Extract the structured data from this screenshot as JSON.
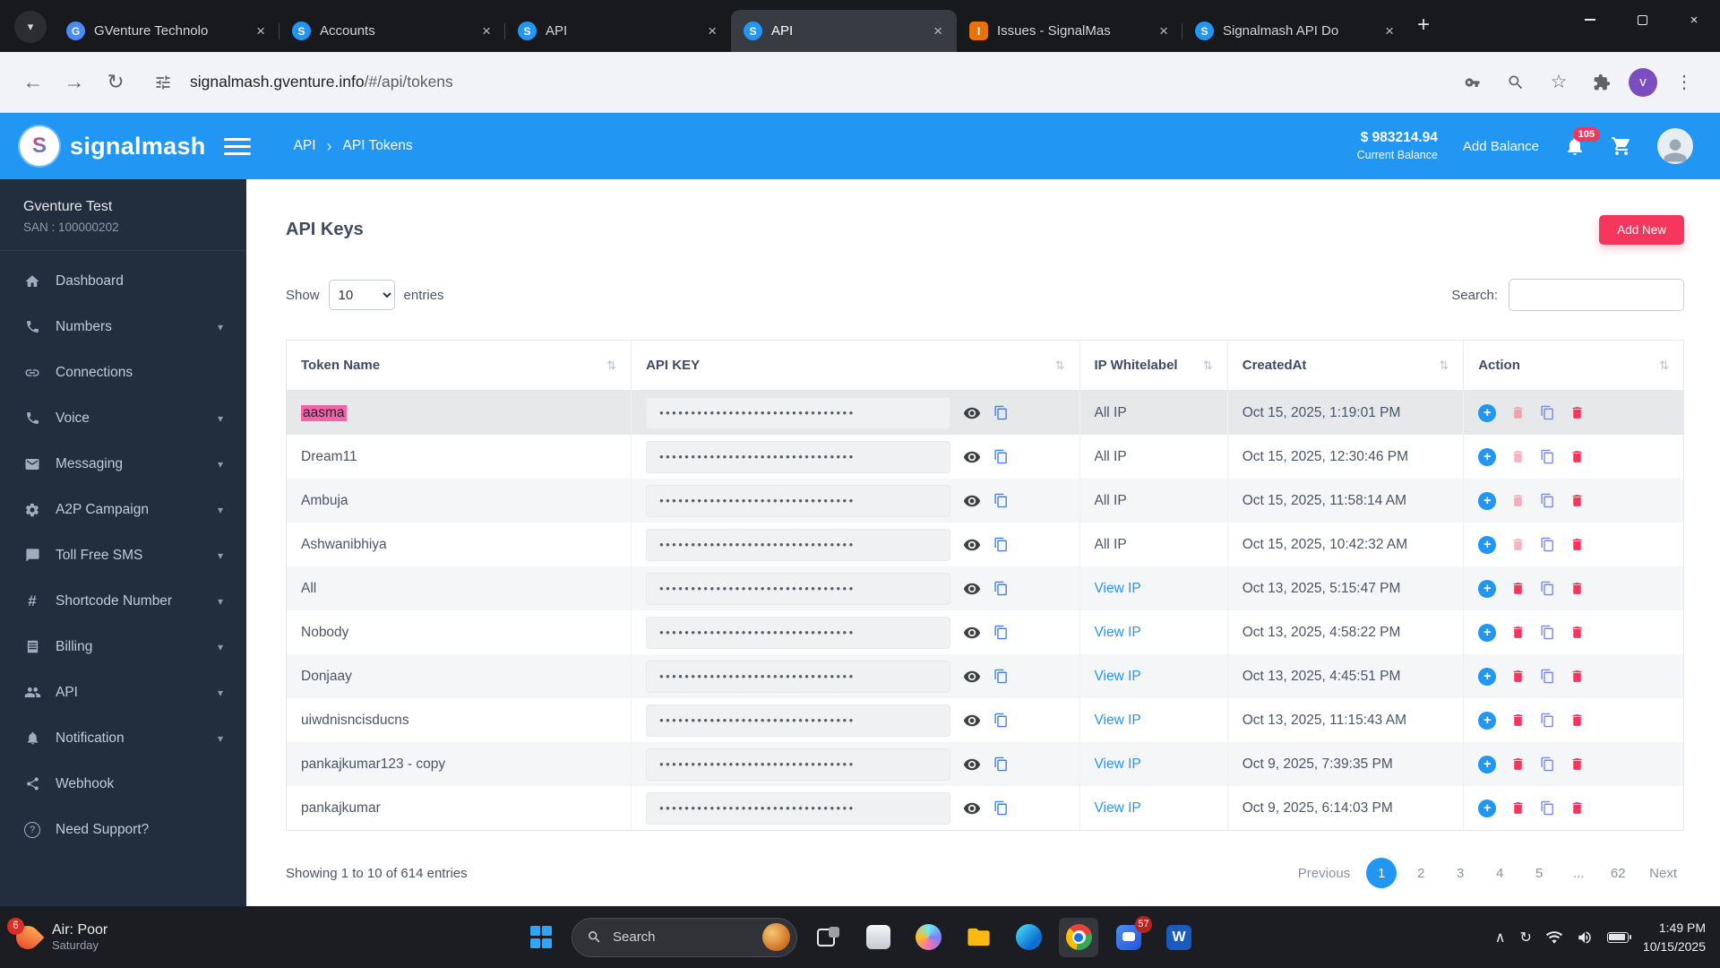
{
  "colors": {
    "appbar_blue": "#2196f3",
    "accent_pink": "#f5365c",
    "link_blue": "#2196f3",
    "highlight_pink": "#f263a8",
    "sidebar_dark": "#222e3e"
  },
  "browser": {
    "tabs": [
      {
        "title": "GVenture Technolo",
        "favicon": "gventure-favicon",
        "favicon_letter": "G"
      },
      {
        "title": "Accounts",
        "favicon": "signalmash-favicon",
        "favicon_letter": "S"
      },
      {
        "title": "API",
        "favicon": "signalmash-favicon",
        "favicon_letter": "S"
      },
      {
        "title": "API",
        "favicon": "signalmash-favicon",
        "favicon_letter": "S"
      },
      {
        "title": "Issues - SignalMas",
        "favicon": "issues-favicon",
        "favicon_letter": "I"
      },
      {
        "title": "Signalmash API Do",
        "favicon": "signalmash-favicon",
        "favicon_letter": "S"
      }
    ],
    "url_host": "signalmash.gventure.info",
    "url_path": "/#/api/tokens",
    "profile_initial": "v"
  },
  "appbar": {
    "logo_letter": "S",
    "brand": "signalmash",
    "breadcrumb_root": "API",
    "breadcrumb_sep": "›",
    "breadcrumb_current": "API Tokens",
    "balance_amount": "$ 983214.94",
    "balance_label": "Current Balance",
    "add_balance_label": "Add Balance",
    "notification_count": "105"
  },
  "sidebar": {
    "account_name": "Gventure Test",
    "account_san": "SAN : 100000202",
    "items": [
      {
        "label": "Dashboard",
        "icon": "home-icon"
      },
      {
        "label": "Numbers",
        "icon": "phone-icon"
      },
      {
        "label": "Connections",
        "icon": "link-icon"
      },
      {
        "label": "Voice",
        "icon": "call-icon"
      },
      {
        "label": "Messaging",
        "icon": "mail-icon"
      },
      {
        "label": "A2P Campaign",
        "icon": "gear-icon"
      },
      {
        "label": "Toll Free SMS",
        "icon": "chat-icon"
      },
      {
        "label": "Shortcode Number",
        "icon": "hash-icon"
      },
      {
        "label": "Billing",
        "icon": "receipt-icon"
      },
      {
        "label": "API",
        "icon": "users-icon"
      },
      {
        "label": "Notification",
        "icon": "bell-icon"
      },
      {
        "label": "Webhook",
        "icon": "webhook-icon"
      },
      {
        "label": "Need Support?",
        "icon": "question-icon"
      }
    ]
  },
  "main": {
    "page_title": "API Keys",
    "add_new_label": "Add New",
    "show_label": "Show",
    "page_size": "10",
    "entries_label": "entries",
    "search_label": "Search:",
    "table": {
      "columns": [
        "Token Name",
        "API KEY",
        "IP Whitelabel",
        "CreatedAt",
        "Action"
      ],
      "masked_key": "•••••••••••••••••••••••••••••••",
      "rows": [
        {
          "name": "aasma",
          "ip": "All IP",
          "created": "Oct 15, 2025, 1:19:01 PM"
        },
        {
          "name": "Dream11",
          "ip": "All IP",
          "created": "Oct 15, 2025, 12:30:46 PM"
        },
        {
          "name": "Ambuja",
          "ip": "All IP",
          "created": "Oct 15, 2025, 11:58:14 AM"
        },
        {
          "name": "Ashwanibhiya",
          "ip": "All IP",
          "created": "Oct 15, 2025, 10:42:32 AM"
        },
        {
          "name": "All",
          "ip": "View IP",
          "created": "Oct 13, 2025, 5:15:47 PM"
        },
        {
          "name": "Nobody",
          "ip": "View IP",
          "created": "Oct 13, 2025, 4:58:22 PM"
        },
        {
          "name": "Donjaay",
          "ip": "View IP",
          "created": "Oct 13, 2025, 4:45:51 PM"
        },
        {
          "name": "uiwdnisncisducns",
          "ip": "View IP",
          "created": "Oct 13, 2025, 11:15:43 AM"
        },
        {
          "name": "pankajkumar123 - copy",
          "ip": "View IP",
          "created": "Oct 9, 2025, 7:39:35 PM"
        },
        {
          "name": "pankajkumar",
          "ip": "View IP",
          "created": "Oct 9, 2025, 6:14:03 PM"
        }
      ]
    },
    "footer_text": "Showing 1 to 10 of 614 entries",
    "pagination": {
      "prev": "Previous",
      "pages": [
        "1",
        "2",
        "3",
        "4",
        "5",
        "...",
        "62"
      ],
      "next": "Next",
      "active": "1"
    }
  },
  "taskbar": {
    "weather_badge": "6",
    "weather_line1": "Air: Poor",
    "weather_line2": "Saturday",
    "search_label": "Search",
    "chat_badge": "57",
    "time": "1:49 PM",
    "date": "10/15/2025"
  }
}
